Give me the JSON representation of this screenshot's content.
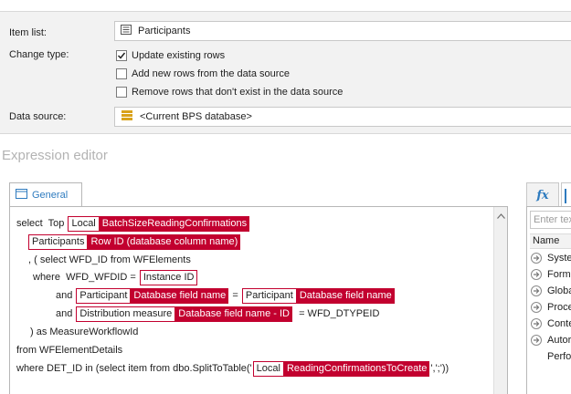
{
  "settings": {
    "item_list_label": "Item list:",
    "item_list_value": "Participants",
    "item_list_icon": "list-icon",
    "change_type_label": "Change type:",
    "options": [
      {
        "label": "Update existing rows",
        "checked": true
      },
      {
        "label": "Add new rows from the data source",
        "checked": false
      },
      {
        "label": "Remove rows that don't exist in the data source",
        "checked": false
      }
    ],
    "data_source_label": "Data source:",
    "data_source_value": "<Current BPS database>",
    "data_source_icon": "database-icon"
  },
  "editor": {
    "title": "Expression editor",
    "tab_label": "General",
    "tab_icon": "window-icon",
    "accent_color": "#c2002f",
    "lines": {
      "l1": {
        "pre": "select  Top ",
        "tok_a": "Local",
        "tok_b": "BatchSizeReadingConfirmations"
      },
      "l2": {
        "tok_a": "Participants",
        "tok_b": "Row ID (database column name)"
      },
      "l3": {
        "text": ", ( select WFD_ID from WFElements"
      },
      "l4": {
        "pre": "where  WFD_WFDID = ",
        "box": "Instance ID"
      },
      "l5": {
        "pre": "and ",
        "tok1_a": "Participant",
        "tok1_b": "Database field name",
        "mid": " = ",
        "tok2_a": "Participant",
        "tok2_b": "Database field name"
      },
      "l6": {
        "pre": "and ",
        "tok_a": "Distribution measure",
        "tok_b": "Database field name - ID",
        "post": "  = WFD_DTYPEID"
      },
      "l7": {
        "text": ") as MeasureWorkflowId"
      },
      "l8": {
        "text": "from WFElementDetails"
      },
      "l9": {
        "pre": "where DET_ID in (select item from dbo.SplitToTable('",
        "tok_a": "Local",
        "tok_b": "ReadingConfirmationsToCreate",
        "post": "',';'))"
      }
    }
  },
  "right_panel": {
    "fx_label": "fx",
    "search_placeholder": "Enter tex",
    "header": "Name",
    "items": [
      "Syste",
      "Form",
      "Globa",
      "Proce",
      "Conte",
      "Autor",
      "Perfo"
    ]
  }
}
